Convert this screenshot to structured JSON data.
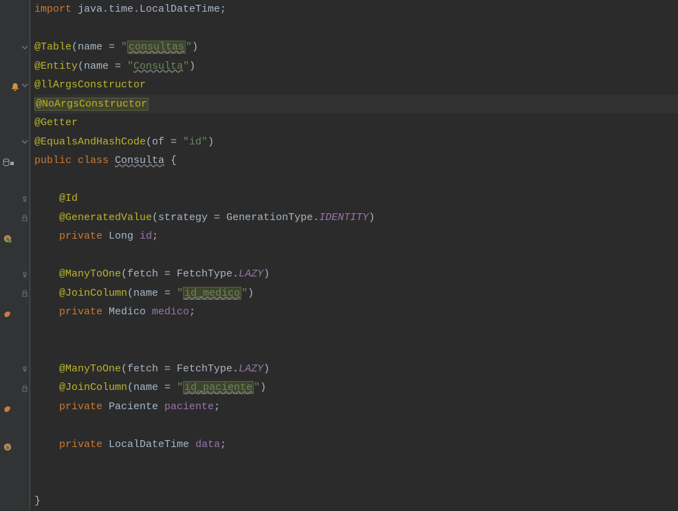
{
  "lines": {
    "l1_importkw": "import",
    "l1_pkg": " java.time.LocalDateTime;",
    "l3_ann": "@Table",
    "l3_open": "(name = ",
    "l3_q1": "\"",
    "l3_str": "consultas",
    "l3_q2": "\"",
    "l3_close": ")",
    "l4_ann": "@Entity",
    "l4_open": "(name = ",
    "l4_q1": "\"",
    "l4_str": "Consulta",
    "l4_q2": "\"",
    "l4_close": ")",
    "l5_ann1": "@",
    "l5_ann2": "llArgsConstructor",
    "l6_ann": "@NoArgsConstructor",
    "l7_ann": "@Getter",
    "l8_ann": "@EqualsAndHashCode",
    "l8_open": "(of = ",
    "l8_str": "\"id\"",
    "l8_close": ")",
    "l9_kw1": "public",
    "l9_kw2": " class ",
    "l9_classname": "Consulta",
    "l9_brace": " {",
    "l11_ann": "@Id",
    "l12_ann": "@GeneratedValue",
    "l12_open": "(strategy = GenerationType.",
    "l12_const": "IDENTITY",
    "l12_close": ")",
    "l13_kw": "private",
    "l13_type": " Long ",
    "l13_var": "id",
    "l13_semi": ";",
    "l15_ann": "@ManyToOne",
    "l15_open": "(fetch = FetchType.",
    "l15_const": "LAZY",
    "l15_close": ")",
    "l16_ann": "@JoinColumn",
    "l16_open": "(name = ",
    "l16_q1": "\"",
    "l16_str": "id_medico",
    "l16_q2": "\"",
    "l16_close": ")",
    "l17_kw": "private",
    "l17_type": " Medico ",
    "l17_var": "medico",
    "l17_semi": ";",
    "l20_ann": "@ManyToOne",
    "l20_open": "(fetch = FetchType.",
    "l20_const": "LAZY",
    "l20_close": ")",
    "l21_ann": "@JoinColumn",
    "l21_open": "(name = ",
    "l21_q1": "\"",
    "l21_str": "id_paciente",
    "l21_q2": "\"",
    "l21_close": ")",
    "l22_kw": "private",
    "l22_type": " Paciente ",
    "l22_var": "paciente",
    "l22_semi": ";",
    "l24_kw": "private",
    "l24_type": " LocalDateTime ",
    "l24_var": "data",
    "l24_semi": ";",
    "l27_brace": "}"
  }
}
